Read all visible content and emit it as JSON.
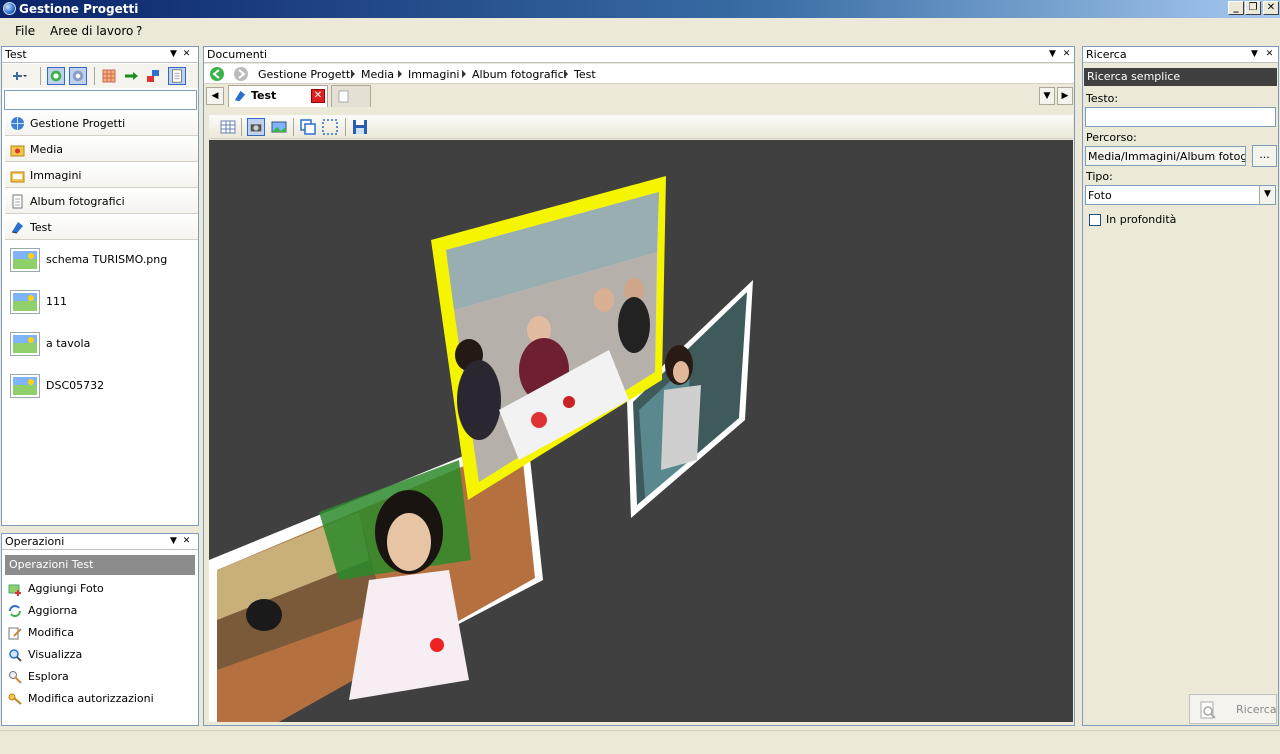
{
  "window": {
    "title": "Gestione Progetti"
  },
  "menu": {
    "items": [
      "File",
      "Aree di lavoro",
      "?"
    ]
  },
  "left_panel": {
    "title": "Test",
    "search_value": "",
    "nav": [
      {
        "label": "Gestione Progetti",
        "icon": "globe-icon"
      },
      {
        "label": "Media",
        "icon": "media-folder-icon"
      },
      {
        "label": "Immagini",
        "icon": "images-folder-icon"
      },
      {
        "label": "Album fotografici",
        "icon": "document-icon"
      },
      {
        "label": "Test",
        "icon": "test-album-icon"
      }
    ],
    "files": [
      "schema TURISMO.png",
      "111",
      "a tavola",
      "DSC05732"
    ]
  },
  "operations_panel": {
    "title": "Operazioni",
    "section": "Operazioni Test",
    "items": [
      {
        "label": "Aggiungi Foto",
        "icon": "add-photo-icon"
      },
      {
        "label": "Aggiorna",
        "icon": "refresh-icon"
      },
      {
        "label": "Modifica",
        "icon": "edit-icon"
      },
      {
        "label": "Visualizza",
        "icon": "view-icon"
      },
      {
        "label": "Esplora",
        "icon": "explore-icon"
      },
      {
        "label": "Modifica autorizzazioni",
        "icon": "keys-icon"
      }
    ]
  },
  "documents_panel": {
    "title": "Documenti",
    "breadcrumb": [
      "Gestione Progetti",
      "Media",
      "Immagini",
      "Album fotografici",
      "Test"
    ],
    "tabs": [
      {
        "label": "Test",
        "active": true
      },
      {
        "label": "",
        "active": false
      }
    ]
  },
  "search_panel": {
    "title": "Ricerca",
    "section": "Ricerca semplice",
    "text_label": "Testo:",
    "text_value": "",
    "path_label": "Percorso:",
    "path_value": "Media/Immagini/Album fotografic",
    "browse_label": "...",
    "type_label": "Tipo:",
    "type_value": "Foto",
    "deep_label": "In profondità",
    "deep_checked": false,
    "search_button": "Ricerca"
  },
  "colors": {
    "accent": "#0a246a",
    "viewer_bg": "#404040",
    "highlight": "#f5f500"
  }
}
